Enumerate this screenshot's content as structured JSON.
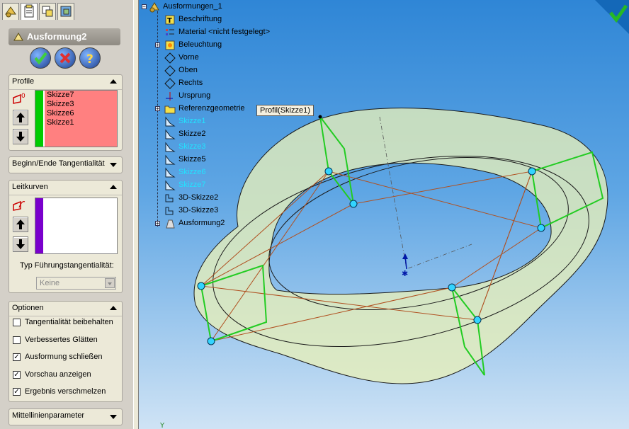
{
  "panel": {
    "feature_title": "Ausformung2",
    "profile": {
      "header": "Profile",
      "items": [
        "Skizze7",
        "Skizze3",
        "Skizze6",
        "Skizze1"
      ]
    },
    "tangency": {
      "header": "Beginn/Ende Tangentialität"
    },
    "guides": {
      "header": "Leitkurven",
      "tangency_label": "Typ Führungstangentialität:",
      "tangency_value": "Keine"
    },
    "options": {
      "header": "Optionen",
      "items": [
        {
          "label": "Tangentialität beibehalten",
          "checked": false
        },
        {
          "label": "Verbessertes Glätten",
          "checked": false
        },
        {
          "label": "Ausformung schließen",
          "checked": true
        },
        {
          "label": "Vorschau anzeigen",
          "checked": true
        },
        {
          "label": "Ergebnis verschmelzen",
          "checked": true
        }
      ]
    },
    "centerline": {
      "header": "Mittellinienparameter"
    }
  },
  "tree": {
    "root": "Ausformungen_1",
    "items": [
      {
        "label": "Beschriftung",
        "icon": "annotation-icon",
        "highlight": false
      },
      {
        "label": "Material <nicht festgelegt>",
        "icon": "material-icon",
        "highlight": false
      },
      {
        "label": "Beleuchtung",
        "icon": "lighting-icon",
        "highlight": false
      },
      {
        "label": "Vorne",
        "icon": "plane-icon",
        "highlight": false
      },
      {
        "label": "Oben",
        "icon": "plane-icon",
        "highlight": false
      },
      {
        "label": "Rechts",
        "icon": "plane-icon",
        "highlight": false
      },
      {
        "label": "Ursprung",
        "icon": "origin-icon",
        "highlight": false
      },
      {
        "label": "Referenzgeometrie",
        "icon": "folder-icon",
        "highlight": false
      },
      {
        "label": "Skizze1",
        "icon": "sketch-icon",
        "highlight": true
      },
      {
        "label": "Skizze2",
        "icon": "sketch-icon",
        "highlight": false
      },
      {
        "label": "Skizze3",
        "icon": "sketch-icon",
        "highlight": true
      },
      {
        "label": "Skizze5",
        "icon": "sketch-icon",
        "highlight": false
      },
      {
        "label": "Skizze6",
        "icon": "sketch-icon",
        "highlight": true
      },
      {
        "label": "Skizze7",
        "icon": "sketch-icon",
        "highlight": true
      },
      {
        "label": "3D-Skizze2",
        "icon": "3d-sketch-icon",
        "highlight": false
      },
      {
        "label": "3D-Skizze3",
        "icon": "3d-sketch-icon",
        "highlight": false
      },
      {
        "label": "Ausformung2",
        "icon": "loft-icon",
        "highlight": false
      }
    ]
  },
  "tooltip": "Profil(Skizze1)",
  "axis_label": "Y",
  "colors": {
    "profile_list_bg": "#ff8080",
    "profile_stripe": "#00cc00",
    "guide_stripe": "#7a00cc",
    "highlight_text": "#22e3ff",
    "loft_surface": "#e8f0b8"
  }
}
